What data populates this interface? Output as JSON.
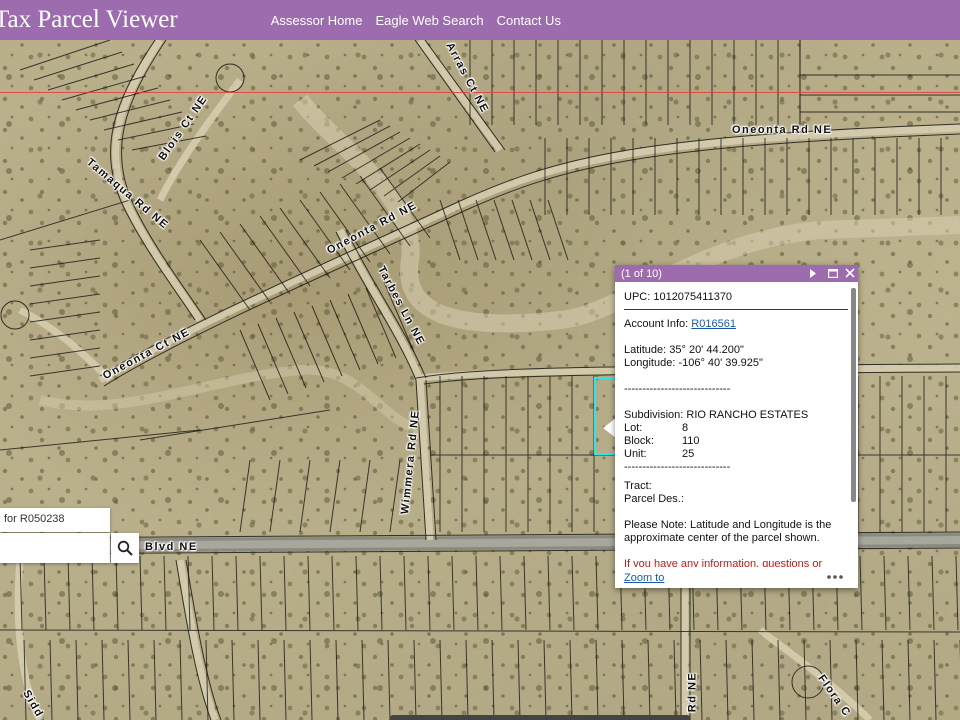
{
  "header": {
    "title": "Tax Parcel Viewer",
    "nav": [
      "Assessor Home",
      "Eagle Web Search",
      "Contact Us"
    ],
    "bg_color": "#9d6cae"
  },
  "map": {
    "road_labels": [
      "Arras Ct NE",
      "Oneonta Rd NE",
      "Blois Ct NE",
      "Tamaqua Rd NE",
      "Oneonta Rd NE",
      "Tarbes Ln NE",
      "Oneonta Ct NE",
      "Wimmera Rd NE",
      "Blvd NE",
      "Rd NE",
      "Flora C",
      "Sidd"
    ]
  },
  "search": {
    "hint": "for R050238",
    "value": ""
  },
  "popup": {
    "counter": "(1 of 10)",
    "upc_label": "UPC: 1012075411370",
    "account_label": "Account Info:",
    "account_link": "R016561",
    "latitude": "Latitude: 35° 20' 44.200\"",
    "longitude": "Longitude: -106° 40' 39.925\"",
    "separator": "-----------------------------",
    "subdivision": "Subdivision: RIO RANCHO ESTATES",
    "lot_label": "Lot:",
    "lot": "8",
    "block_label": "Block:",
    "block": "110",
    "unit_label": "Unit:",
    "unit": "25",
    "separator2": "-----------------------------",
    "tract": "Tract:",
    "parcel_des": "Parcel Des.:",
    "note": "Please Note: Latitude and Longitude is the approximate center of the parcel shown.",
    "warning": "If you have any information, questions or concerns about this parcel, please contact",
    "zoom_to": "Zoom to",
    "accent": "#9d6cae"
  }
}
